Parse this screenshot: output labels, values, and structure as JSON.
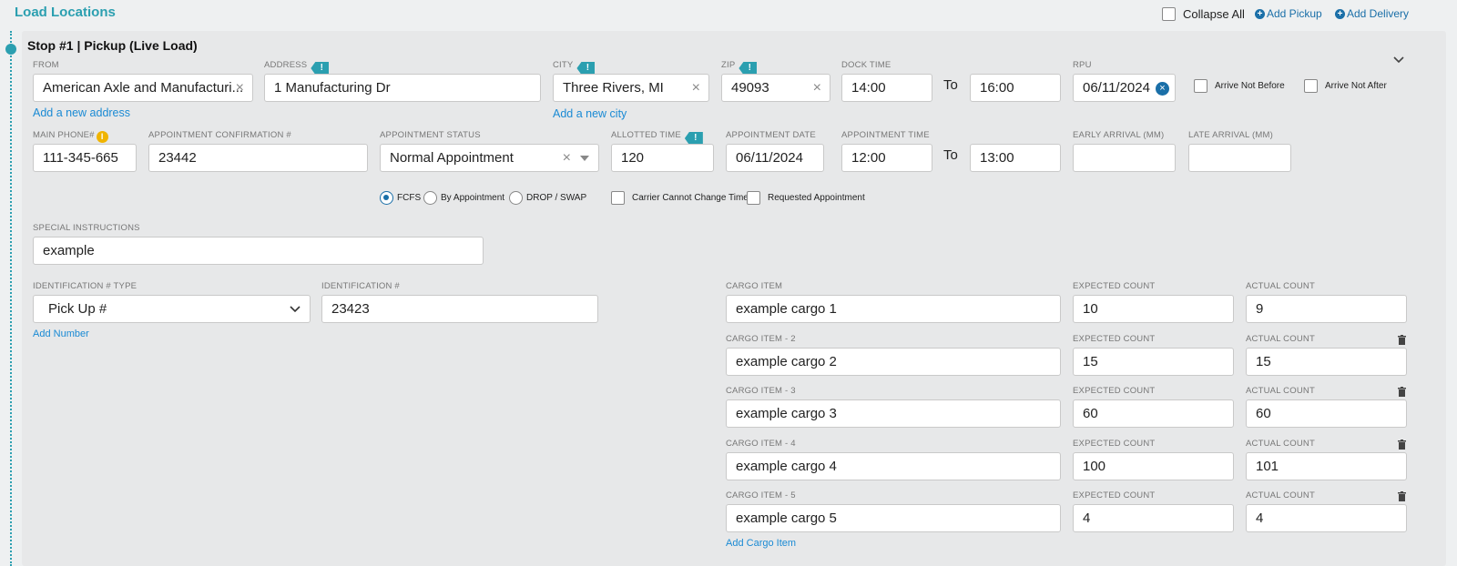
{
  "header": {
    "title": "Load Locations",
    "collapse_all": "Collapse All",
    "add_pickup": "Add Pickup",
    "add_delivery": "Add Delivery"
  },
  "stop": {
    "title": "Stop #1 | Pickup (Live Load)",
    "from": {
      "label": "FROM",
      "value": "American Axle and Manufacturi..."
    },
    "address": {
      "label": "ADDRESS",
      "value": "1 Manufacturing Dr"
    },
    "city": {
      "label": "CITY",
      "value": "Three Rivers, MI"
    },
    "zip": {
      "label": "ZIP",
      "value": "49093"
    },
    "dock_time": {
      "label": "DOCK TIME",
      "start": "14:00",
      "end": "16:00"
    },
    "to_label": "To",
    "rpu": {
      "label": "RPU",
      "value": "06/11/2024"
    },
    "arrive_not_before": "Arrive Not Before",
    "arrive_not_after": "Arrive Not After",
    "add_new_address": "Add a new address",
    "add_new_city": "Add a new city",
    "main_phone": {
      "label": "MAIN PHONE#",
      "value": "111-345-665"
    },
    "appt_confirmation": {
      "label": "APPOINTMENT CONFIRMATION #",
      "value": "23442"
    },
    "appt_status": {
      "label": "APPOINTMENT STATUS",
      "value": "Normal Appointment"
    },
    "allotted_time": {
      "label": "ALLOTTED TIME",
      "value": "120"
    },
    "appt_date": {
      "label": "APPOINTMENT DATE",
      "value": "06/11/2024"
    },
    "appt_time": {
      "label": "APPOINTMENT TIME",
      "start": "12:00",
      "end": "13:00"
    },
    "early_arrival": {
      "label": "EARLY ARRIVAL (MM)",
      "value": ""
    },
    "late_arrival": {
      "label": "LATE ARRIVAL (MM)",
      "value": ""
    },
    "radios": {
      "fcfs": "FCFS",
      "by_appointment": "By Appointment",
      "drop_swap": "DROP / SWAP"
    },
    "carrier_cannot_change": "Carrier Cannot Change Time",
    "requested_appointment": "Requested Appointment",
    "special_instructions": {
      "label": "SPECIAL INSTRUCTIONS",
      "value": "example"
    },
    "id_type": {
      "label": "IDENTIFICATION # TYPE",
      "value": "Pick Up #"
    },
    "id_number": {
      "label": "IDENTIFICATION #",
      "value": "23423"
    },
    "add_number": "Add Number",
    "cargo": [
      {
        "label": "CARGO ITEM",
        "value": "example cargo 1",
        "expected_label": "EXPECTED COUNT",
        "expected": "10",
        "actual_label": "ACTUAL COUNT",
        "actual": "9"
      },
      {
        "label": "CARGO ITEM - 2",
        "value": "example cargo 2",
        "expected_label": "EXPECTED COUNT",
        "expected": "15",
        "actual_label": "ACTUAL COUNT",
        "actual": "15"
      },
      {
        "label": "CARGO ITEM - 3",
        "value": "example cargo 3",
        "expected_label": "EXPECTED COUNT",
        "expected": "60",
        "actual_label": "ACTUAL COUNT",
        "actual": "60"
      },
      {
        "label": "CARGO ITEM - 4",
        "value": "example cargo 4",
        "expected_label": "EXPECTED COUNT",
        "expected": "100",
        "actual_label": "ACTUAL COUNT",
        "actual": "101"
      },
      {
        "label": "CARGO ITEM - 5",
        "value": "example cargo 5",
        "expected_label": "EXPECTED COUNT",
        "expected": "4",
        "actual_label": "ACTUAL COUNT",
        "actual": "4"
      }
    ],
    "add_cargo_item": "Add Cargo Item"
  }
}
